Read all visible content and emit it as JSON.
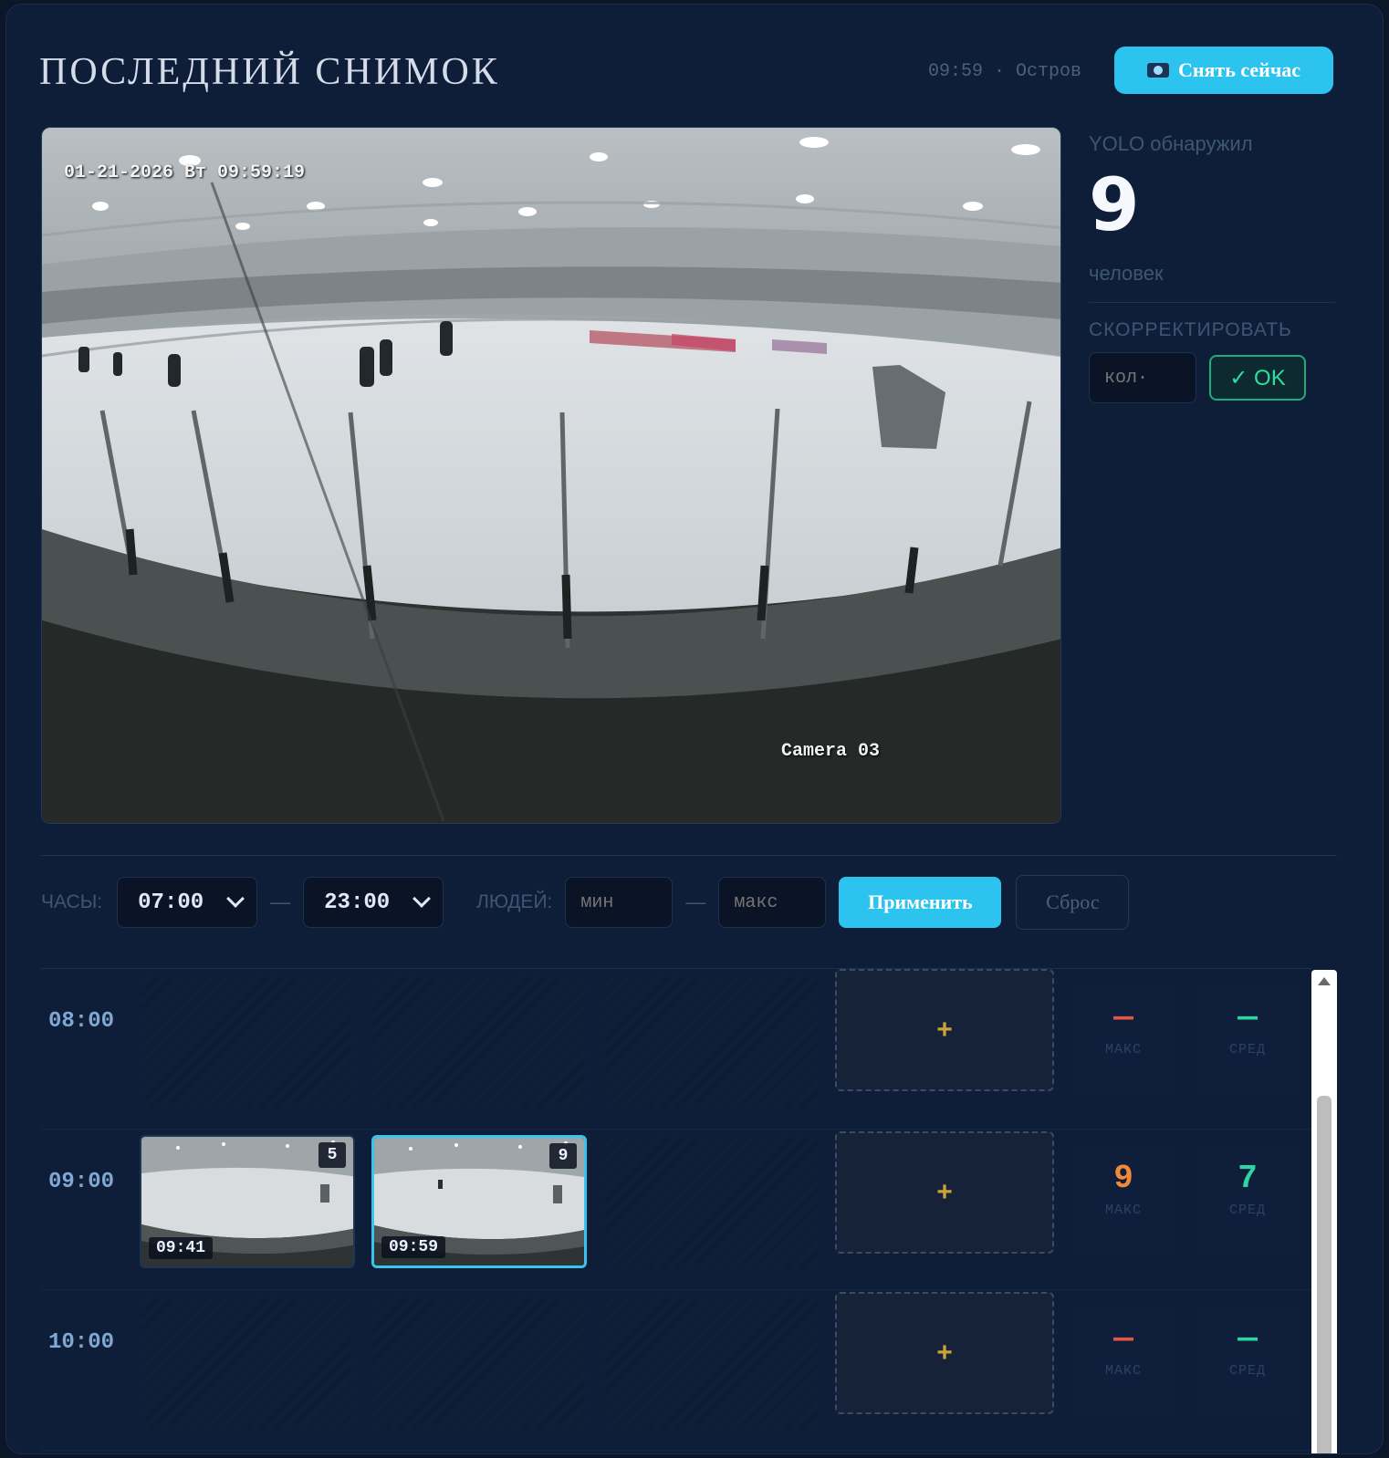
{
  "header": {
    "title": "ПОСЛЕДНИЙ СНИМОК",
    "meta": "09:59 · Остров",
    "snap_button": "Снять сейчас",
    "snap_icon": "camera-icon"
  },
  "snapshot": {
    "timestamp": "01-21-2026 Вт 09:59:19",
    "camera": "Camera 03"
  },
  "side": {
    "yolo_label": "YOLO обнаружил",
    "count": "9",
    "unit": "человек",
    "correct_label": "СКОРРЕКТИРОВАТЬ",
    "qty_placeholder": "кол·",
    "ok_button": "✓ OK"
  },
  "filters": {
    "hours_label": "ЧАСЫ:",
    "hour_from": "07:00",
    "hour_to": "23:00",
    "dash": "—",
    "people_label": "ЛЮДЕЙ:",
    "min_placeholder": "мин",
    "max_placeholder": "макс",
    "apply_button": "Применить",
    "reset_button": "Сброс"
  },
  "grid": {
    "max_label": "МАКС",
    "avg_label": "СРЕД",
    "add_symbol": "+",
    "rows": [
      {
        "hour": "08:00",
        "max": "—",
        "avg": "—"
      },
      {
        "hour": "09:00",
        "max": "9",
        "avg": "7",
        "thumbs": [
          {
            "time": "09:41",
            "count": "5"
          },
          {
            "time": "09:59",
            "count": "9"
          }
        ]
      },
      {
        "hour": "10:00",
        "max": "—",
        "avg": "—"
      }
    ]
  },
  "colors": {
    "accent": "#2cc4ef",
    "ok_green": "#2de0a0",
    "max_orange": "#f08a3a",
    "max_dash_red": "#e0574a",
    "avg_green": "#2dd5a0"
  }
}
